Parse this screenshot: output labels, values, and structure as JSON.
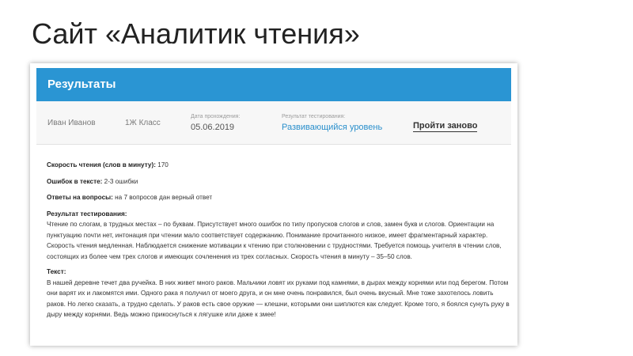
{
  "slide": {
    "title": "Сайт «Аналитик чтения»"
  },
  "card": {
    "header_title": "Результаты",
    "student": {
      "name": "Иван Иванов",
      "class": "1Ж Класс"
    },
    "date": {
      "label": "Дата прохождения:",
      "value": "05.06.2019"
    },
    "result": {
      "label": "Результат тестирования:",
      "value": "Развивающийся уровень"
    },
    "retry_label": "Пройти заново"
  },
  "details": {
    "speed": {
      "label": "Скорость чтения (слов в минуту):",
      "value": " 170"
    },
    "errors": {
      "label": "Ошибок в тексте:",
      "value": " 2-3 ошибки"
    },
    "answers": {
      "label": "Ответы на вопросы:",
      "value": " на 7 вопросов дан верный ответ"
    },
    "test_result": {
      "label": "Результат тестирования:",
      "text": "Чтение по слогам, в трудных местах – по буквам. Присутствует много ошибок по типу пропусков слогов и слов, замен букв и слогов. Ориентации на пунктуацию почти нет, интонация при чтении мало соответствует содержанию. Понимание прочитанного низкое, имеет фрагментарный характер. Скорость чтения медленная. Наблюдается снижение мотивации к чтению при столкновении с трудностями. Требуется помощь учителя в чтении слов, состоящих из более чем трех слогов и имеющих сочленения из трех согласных. Скорость чтения в минуту – 35–50 слов."
    },
    "text": {
      "label": "Текст:",
      "text": "В нашей деревне течет два ручейка. В них живет много раков. Мальчики ловят их руками под камнями, в дырах между корнями или под берегом. Потом они варят их и лакомятся ими. Одного рака я получил от моего друга, и он мне очень понравился, был очень вкусный. Мне тоже захотелось ловить раков. Но легко сказать, а трудно сделать. У раков есть свое оружие — клешни, которыми они шиплются как следует. Кроме того, я боялся сунуть руку в дыру между корнями. Ведь можно прикоснуться к лягушке или даже к змее!"
    }
  },
  "colors": {
    "header_blue": "#2a95d3",
    "link_blue": "#2a8fcc"
  }
}
